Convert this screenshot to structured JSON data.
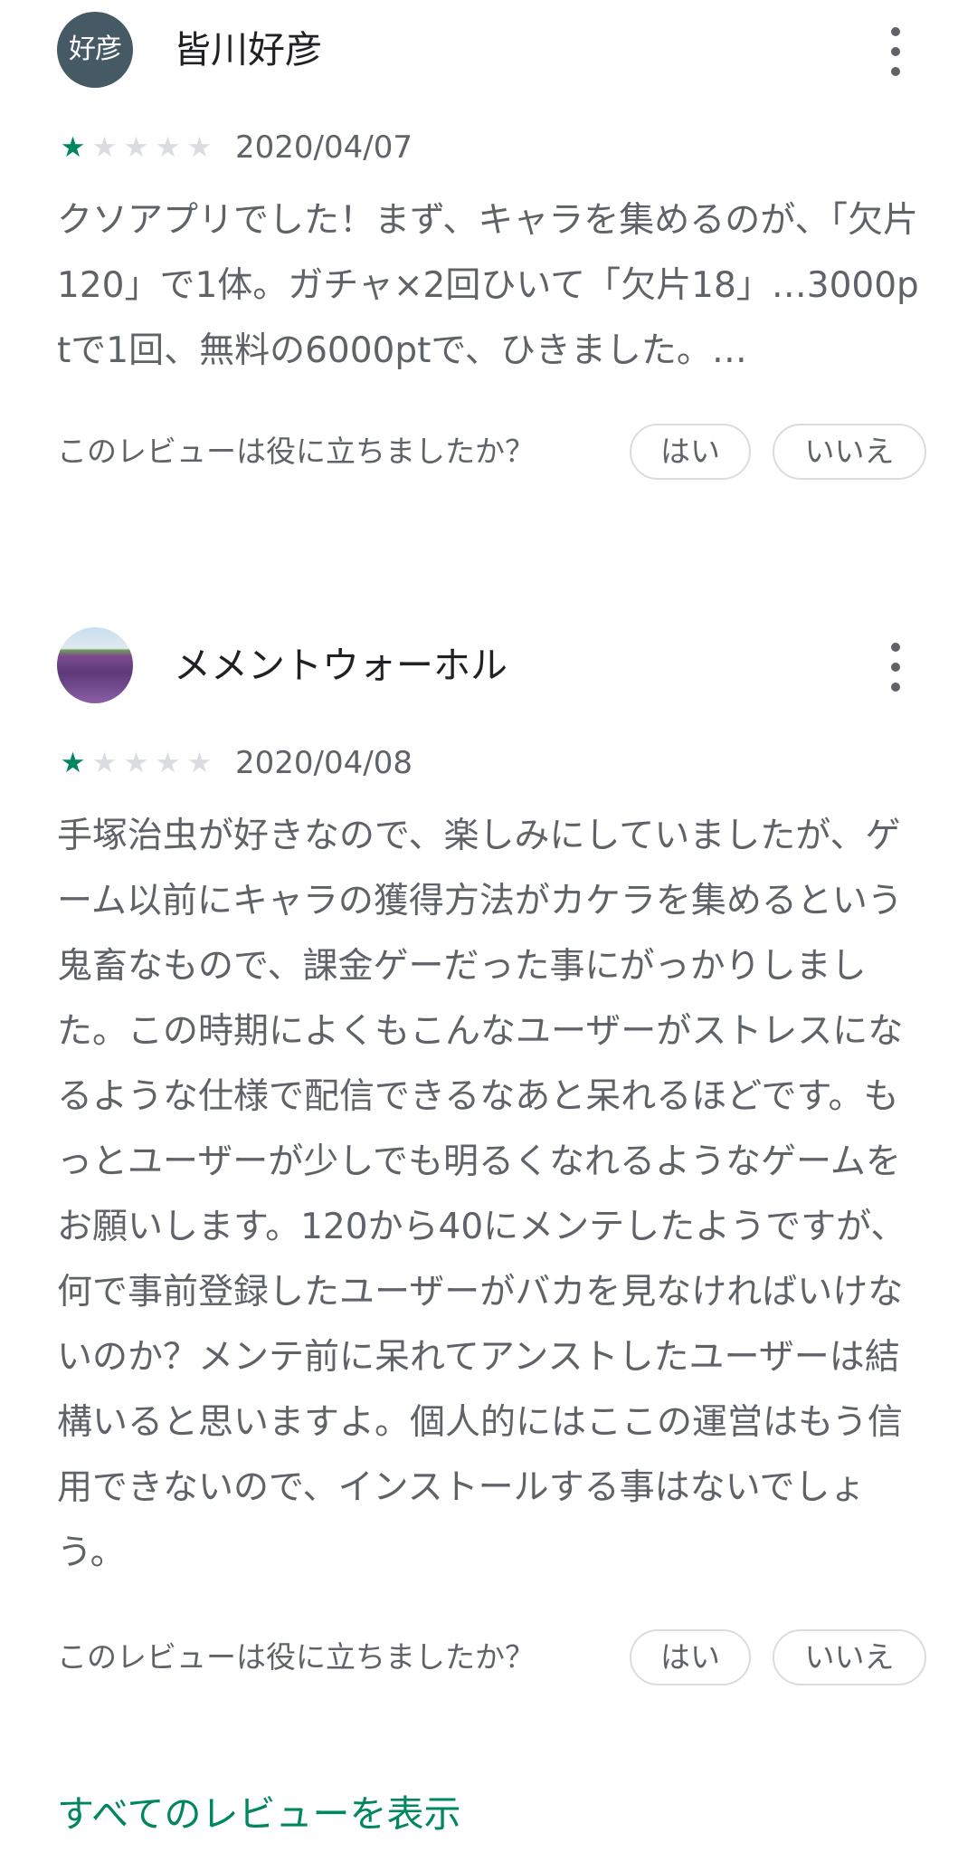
{
  "reviews": [
    {
      "author": "皆川好彦",
      "avatar_text": "好彦",
      "avatar_kind": "initials",
      "rating": 1,
      "rating_max": 5,
      "date": "2020/04/07",
      "text": "クソアプリでした！まず、キャラを集めるのが、「欠片120」で1体。ガチャ×2回ひいて「欠片18」…3000ptで1回、無料の6000ptで、ひきました。…",
      "helpful_label": "このレビューは役に立ちましたか？",
      "yes_label": "はい",
      "no_label": "いいえ"
    },
    {
      "author": "メメントウォーホル",
      "avatar_text": "",
      "avatar_kind": "photo",
      "rating": 1,
      "rating_max": 5,
      "date": "2020/04/08",
      "text": "手塚治虫が好きなので、楽しみにしていましたが、ゲーム以前にキャラの獲得方法がカケラを集めるという鬼畜なもので、課金ゲーだった事にがっかりしました。この時期によくもこんなユーザーがストレスになるような仕様で配信できるなあと呆れるほどです。もっとユーザーが少しでも明るくなれるようなゲームをお願いします。120から40にメンテしたようですが、何で事前登録したユーザーがバカを見なければいけないのか？メンテ前に呆れてアンストしたユーザーは結構いると思いますよ。個人的にはここの運営はもう信用できないので、インストールする事はないでしょう。",
      "helpful_label": "このレビューは役に立ちましたか？",
      "yes_label": "はい",
      "no_label": "いいえ"
    }
  ],
  "footer": {
    "all_reviews_label": "すべてのレビューを表示"
  },
  "colors": {
    "accent": "#01875f",
    "star_empty": "#dadce0",
    "text_secondary": "#5f6368",
    "text_primary": "#202124"
  },
  "icons": {
    "more": "more-vert-icon",
    "star": "star-icon"
  }
}
